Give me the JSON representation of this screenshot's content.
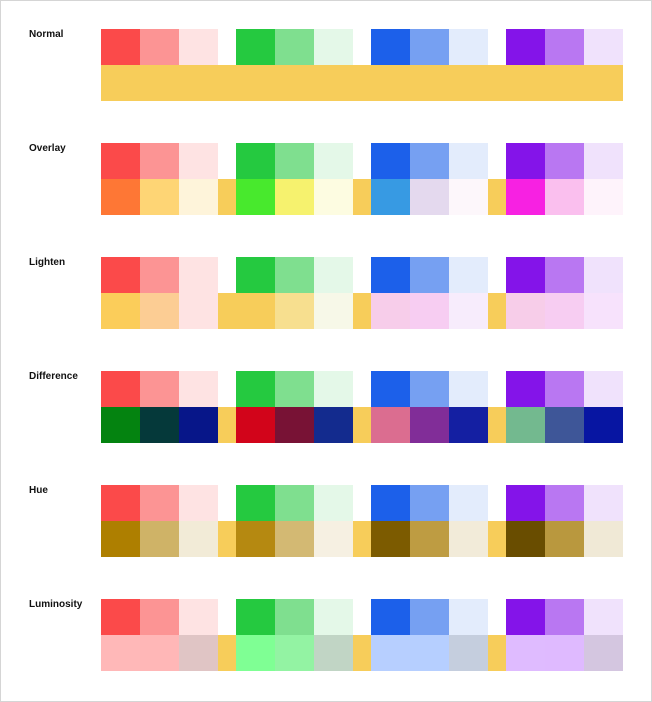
{
  "band_color": "#f7cd5a",
  "modes": [
    {
      "id": "normal",
      "label": "Normal",
      "blend": "normal"
    },
    {
      "id": "overlay",
      "label": "Overlay",
      "blend": "overlay"
    },
    {
      "id": "lighten",
      "label": "Lighten",
      "blend": "lighten"
    },
    {
      "id": "difference",
      "label": "Difference",
      "blend": "difference"
    },
    {
      "id": "hue",
      "label": "Hue",
      "blend": "hue"
    },
    {
      "id": "luminosity",
      "label": "Luminosity",
      "blend": "luminosity"
    }
  ],
  "groups": [
    {
      "id": "red",
      "swatches": [
        "#fb4a4a",
        "#fc9494",
        "#fee3e3"
      ]
    },
    {
      "id": "green",
      "swatches": [
        "#25c940",
        "#7fdf8f",
        "#e4f8e8"
      ]
    },
    {
      "id": "blue",
      "swatches": [
        "#1c60ea",
        "#76a0f2",
        "#e3ecfc"
      ]
    },
    {
      "id": "purple",
      "swatches": [
        "#8414e9",
        "#b977f2",
        "#f0e2fc"
      ]
    }
  ]
}
